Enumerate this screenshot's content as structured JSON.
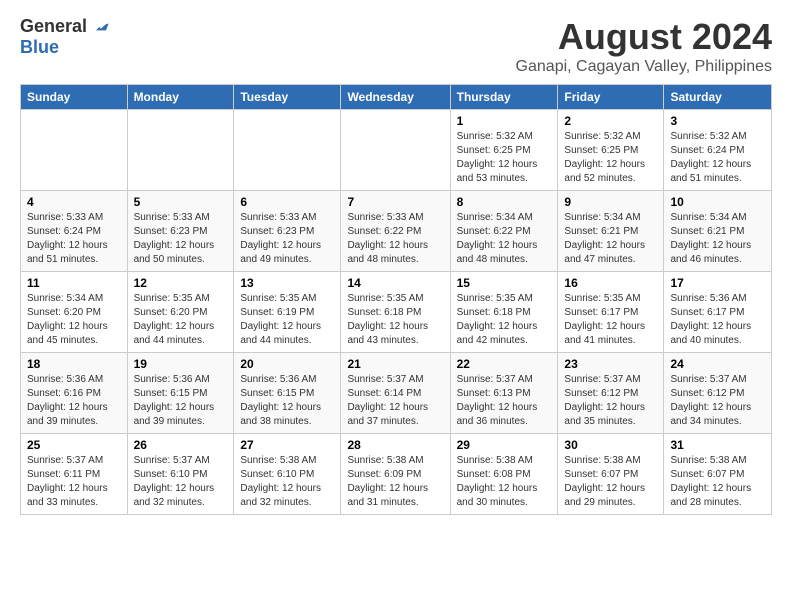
{
  "logo": {
    "general": "General",
    "blue": "Blue"
  },
  "header": {
    "month_year": "August 2024",
    "location": "Ganapi, Cagayan Valley, Philippines"
  },
  "days_of_week": [
    "Sunday",
    "Monday",
    "Tuesday",
    "Wednesday",
    "Thursday",
    "Friday",
    "Saturday"
  ],
  "weeks": [
    [
      {
        "day": "",
        "info": ""
      },
      {
        "day": "",
        "info": ""
      },
      {
        "day": "",
        "info": ""
      },
      {
        "day": "",
        "info": ""
      },
      {
        "day": "1",
        "info": "Sunrise: 5:32 AM\nSunset: 6:25 PM\nDaylight: 12 hours\nand 53 minutes."
      },
      {
        "day": "2",
        "info": "Sunrise: 5:32 AM\nSunset: 6:25 PM\nDaylight: 12 hours\nand 52 minutes."
      },
      {
        "day": "3",
        "info": "Sunrise: 5:32 AM\nSunset: 6:24 PM\nDaylight: 12 hours\nand 51 minutes."
      }
    ],
    [
      {
        "day": "4",
        "info": "Sunrise: 5:33 AM\nSunset: 6:24 PM\nDaylight: 12 hours\nand 51 minutes."
      },
      {
        "day": "5",
        "info": "Sunrise: 5:33 AM\nSunset: 6:23 PM\nDaylight: 12 hours\nand 50 minutes."
      },
      {
        "day": "6",
        "info": "Sunrise: 5:33 AM\nSunset: 6:23 PM\nDaylight: 12 hours\nand 49 minutes."
      },
      {
        "day": "7",
        "info": "Sunrise: 5:33 AM\nSunset: 6:22 PM\nDaylight: 12 hours\nand 48 minutes."
      },
      {
        "day": "8",
        "info": "Sunrise: 5:34 AM\nSunset: 6:22 PM\nDaylight: 12 hours\nand 48 minutes."
      },
      {
        "day": "9",
        "info": "Sunrise: 5:34 AM\nSunset: 6:21 PM\nDaylight: 12 hours\nand 47 minutes."
      },
      {
        "day": "10",
        "info": "Sunrise: 5:34 AM\nSunset: 6:21 PM\nDaylight: 12 hours\nand 46 minutes."
      }
    ],
    [
      {
        "day": "11",
        "info": "Sunrise: 5:34 AM\nSunset: 6:20 PM\nDaylight: 12 hours\nand 45 minutes."
      },
      {
        "day": "12",
        "info": "Sunrise: 5:35 AM\nSunset: 6:20 PM\nDaylight: 12 hours\nand 44 minutes."
      },
      {
        "day": "13",
        "info": "Sunrise: 5:35 AM\nSunset: 6:19 PM\nDaylight: 12 hours\nand 44 minutes."
      },
      {
        "day": "14",
        "info": "Sunrise: 5:35 AM\nSunset: 6:18 PM\nDaylight: 12 hours\nand 43 minutes."
      },
      {
        "day": "15",
        "info": "Sunrise: 5:35 AM\nSunset: 6:18 PM\nDaylight: 12 hours\nand 42 minutes."
      },
      {
        "day": "16",
        "info": "Sunrise: 5:35 AM\nSunset: 6:17 PM\nDaylight: 12 hours\nand 41 minutes."
      },
      {
        "day": "17",
        "info": "Sunrise: 5:36 AM\nSunset: 6:17 PM\nDaylight: 12 hours\nand 40 minutes."
      }
    ],
    [
      {
        "day": "18",
        "info": "Sunrise: 5:36 AM\nSunset: 6:16 PM\nDaylight: 12 hours\nand 39 minutes."
      },
      {
        "day": "19",
        "info": "Sunrise: 5:36 AM\nSunset: 6:15 PM\nDaylight: 12 hours\nand 39 minutes."
      },
      {
        "day": "20",
        "info": "Sunrise: 5:36 AM\nSunset: 6:15 PM\nDaylight: 12 hours\nand 38 minutes."
      },
      {
        "day": "21",
        "info": "Sunrise: 5:37 AM\nSunset: 6:14 PM\nDaylight: 12 hours\nand 37 minutes."
      },
      {
        "day": "22",
        "info": "Sunrise: 5:37 AM\nSunset: 6:13 PM\nDaylight: 12 hours\nand 36 minutes."
      },
      {
        "day": "23",
        "info": "Sunrise: 5:37 AM\nSunset: 6:12 PM\nDaylight: 12 hours\nand 35 minutes."
      },
      {
        "day": "24",
        "info": "Sunrise: 5:37 AM\nSunset: 6:12 PM\nDaylight: 12 hours\nand 34 minutes."
      }
    ],
    [
      {
        "day": "25",
        "info": "Sunrise: 5:37 AM\nSunset: 6:11 PM\nDaylight: 12 hours\nand 33 minutes."
      },
      {
        "day": "26",
        "info": "Sunrise: 5:37 AM\nSunset: 6:10 PM\nDaylight: 12 hours\nand 32 minutes."
      },
      {
        "day": "27",
        "info": "Sunrise: 5:38 AM\nSunset: 6:10 PM\nDaylight: 12 hours\nand 32 minutes."
      },
      {
        "day": "28",
        "info": "Sunrise: 5:38 AM\nSunset: 6:09 PM\nDaylight: 12 hours\nand 31 minutes."
      },
      {
        "day": "29",
        "info": "Sunrise: 5:38 AM\nSunset: 6:08 PM\nDaylight: 12 hours\nand 30 minutes."
      },
      {
        "day": "30",
        "info": "Sunrise: 5:38 AM\nSunset: 6:07 PM\nDaylight: 12 hours\nand 29 minutes."
      },
      {
        "day": "31",
        "info": "Sunrise: 5:38 AM\nSunset: 6:07 PM\nDaylight: 12 hours\nand 28 minutes."
      }
    ]
  ]
}
